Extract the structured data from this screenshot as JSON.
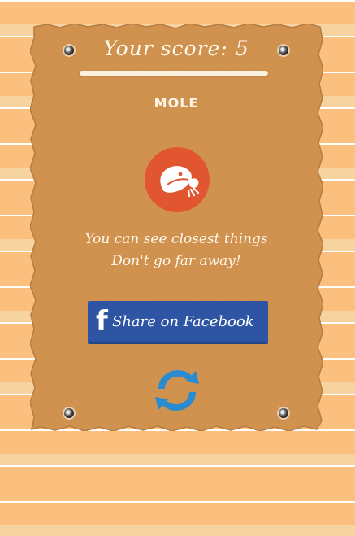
{
  "score": {
    "label": "Your score: 5"
  },
  "result": {
    "animal": "MOLE",
    "icon": "mole-icon",
    "description_line1": "You can see closest things",
    "description_line2": "Don't go far away!"
  },
  "share": {
    "icon": "facebook-icon",
    "icon_glyph": "f",
    "label": "Share on Facebook"
  },
  "replay": {
    "icon": "replay-icon"
  },
  "colors": {
    "background": "#fbc07d",
    "board": "#d58f47",
    "badge": "#e25531",
    "facebook": "#2d55a4",
    "replay": "#2b8bd0"
  }
}
